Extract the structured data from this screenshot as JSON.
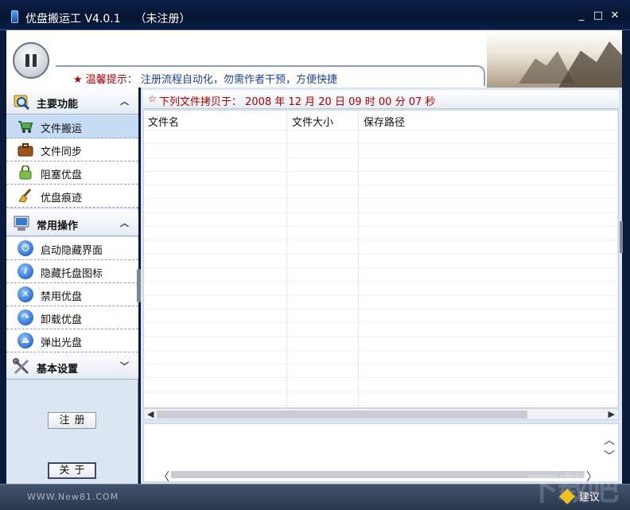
{
  "window": {
    "title": "优盘搬运工 V4.0.1    （未注册）",
    "controls": {
      "minimize": "_",
      "maximize": "□",
      "close": "✕"
    }
  },
  "header": {
    "tip_label": "温馨提示：",
    "tip_text": "注册流程自动化，勿需作者干预，方便快捷"
  },
  "sidebar": {
    "sections": [
      {
        "title": "主要功能",
        "chevron": "⌃",
        "icon": "magnifier-icon"
      },
      {
        "title": "常用操作",
        "chevron": "⌃",
        "icon": "computer-icon"
      },
      {
        "title": "基本设置",
        "chevron": "⌄",
        "icon": "tools-icon"
      }
    ],
    "main_items": [
      {
        "label": "文件搬运",
        "icon": "cart-icon",
        "selected": true
      },
      {
        "label": "文件同步",
        "icon": "briefcase-icon"
      },
      {
        "label": "阻塞优盘",
        "icon": "lock-icon"
      },
      {
        "label": "优盘痕迹",
        "icon": "broom-icon"
      }
    ],
    "ops_items": [
      {
        "label": "启动隐藏界面",
        "icon": "power-icon",
        "glyph": "⏻"
      },
      {
        "label": "隐藏托盘图标",
        "icon": "info-icon",
        "glyph": "i"
      },
      {
        "label": "禁用优盘",
        "icon": "disable-icon",
        "glyph": "✕"
      },
      {
        "label": "卸载优盘",
        "icon": "unmount-icon",
        "glyph": "↷"
      },
      {
        "label": "弹出光盘",
        "icon": "eject-icon",
        "glyph": "⏏"
      }
    ],
    "register_label": "注册",
    "about_label": "关于"
  },
  "main": {
    "list_title": "下列文件拷贝于： 2008 年 12 月 20 日 09 时 00 分 07 秒",
    "columns": [
      "文件名",
      "文件大小",
      "保存路径"
    ],
    "rows": []
  },
  "status": {
    "site": "WWW.New81.COM",
    "suggest_label": "建议",
    "watermark": "下载吧"
  },
  "colors": {
    "title_bg": "#061530",
    "accent_red": "#b30000",
    "tip_blue": "#1c3f99",
    "sidebar_bg": "#dbe6f2",
    "selected_item": "#c6dcf5"
  }
}
